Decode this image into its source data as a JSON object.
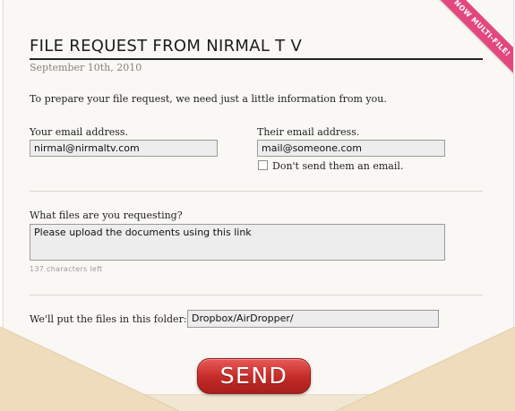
{
  "ribbon": {
    "text": "NOW MULTI-FILE!"
  },
  "header": {
    "title": "FILE REQUEST FROM NIRMAL T V",
    "date": "September 10th, 2010"
  },
  "intro": "To prepare your file request, we need just a little information from you.",
  "your_email": {
    "label": "Your email address.",
    "value": "nirmal@nirmaltv.com"
  },
  "their_email": {
    "label": "Their email address.",
    "value": "mail@someone.com"
  },
  "dont_send": {
    "label": "Don't send them an email.",
    "checked": false
  },
  "files": {
    "label": "What files are you requesting?",
    "value": "Please upload the documents using this link",
    "chars_left": "137 characters left"
  },
  "folder": {
    "label": "We'll put the files in this folder:",
    "value": "Dropbox/AirDropper/"
  },
  "send_button": {
    "label": "SEND"
  },
  "colors": {
    "ribbon": "#e2487e",
    "send": "#c32a27",
    "envelope": "#f1e6d2"
  }
}
